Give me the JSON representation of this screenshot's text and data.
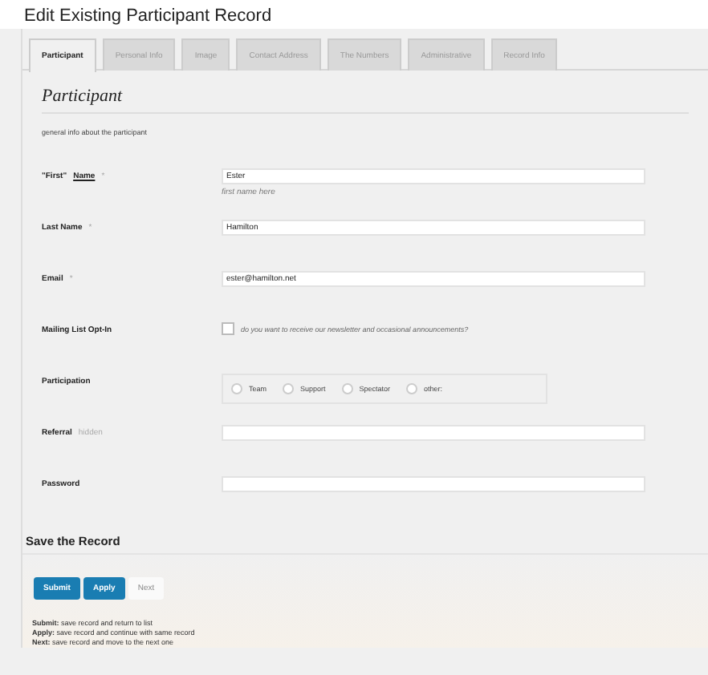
{
  "window": {
    "title": "Edit Existing Participant Record"
  },
  "tabs": [
    {
      "label": "Participant",
      "selected": true
    },
    {
      "label": "Personal Info",
      "selected": false
    },
    {
      "label": "Image",
      "selected": false
    },
    {
      "label": "Contact Address",
      "selected": false
    },
    {
      "label": "The Numbers",
      "selected": false
    },
    {
      "label": "Administrative",
      "selected": false
    },
    {
      "label": "Record Info",
      "selected": false
    }
  ],
  "section": {
    "title": "Participant",
    "description": "general info about the participant"
  },
  "fields": [
    {
      "kind": "text",
      "label": "\"First\"",
      "underlined": "Name",
      "marker": "*",
      "value": "Ester",
      "help": "first name here"
    },
    {
      "kind": "text",
      "label": "Last Name",
      "marker": "*",
      "value": "Hamilton"
    },
    {
      "kind": "text",
      "label": "Email",
      "marker": "*",
      "value": "ester@hamilton.net"
    },
    {
      "kind": "checkbox",
      "label": "Mailing List Opt-In",
      "checked": false,
      "text": "do you want to receive our newsletter and occasional announcements?"
    },
    {
      "kind": "radio",
      "label": "Participation",
      "options": [
        {
          "label": "Team",
          "selected": false
        },
        {
          "label": "Support",
          "selected": false
        },
        {
          "label": "Spectator",
          "selected": false
        },
        {
          "label": "other:",
          "selected": false
        }
      ]
    },
    {
      "kind": "text",
      "label": "Referral",
      "note": "hidden"
    },
    {
      "kind": "password",
      "label": "Password"
    }
  ],
  "save": {
    "title": "Save the Record",
    "buttons": [
      {
        "label": "Submit",
        "kind": "primary"
      },
      {
        "label": "Apply",
        "kind": "primary"
      },
      {
        "label": "Next",
        "kind": "plain"
      }
    ],
    "notes": [
      "**Submit:** save record and return to list",
      "**Apply:** save record and continue with same record",
      "**Next:** save record and move to the next one"
    ]
  }
}
